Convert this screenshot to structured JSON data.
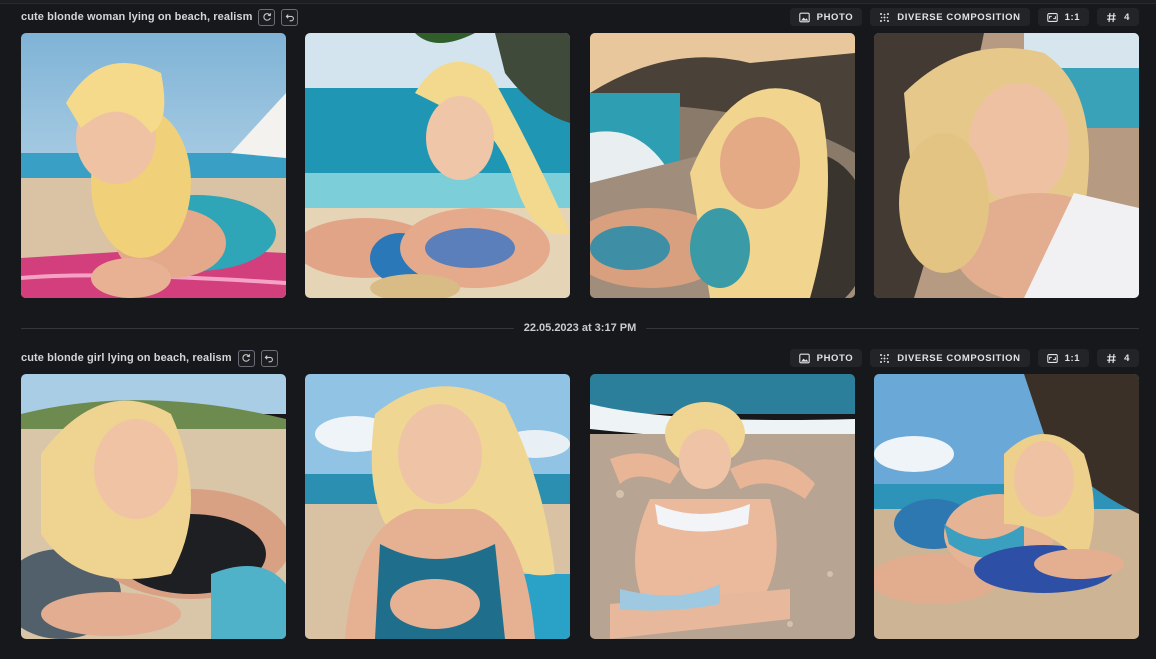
{
  "groups": [
    {
      "prompt": "cute blonde woman lying on beach, realism",
      "tags": {
        "style": "PHOTO",
        "composition": "DIVERSE COMPOSITION",
        "ratio": "1:1",
        "count": "4"
      },
      "images": [
        {
          "alt": "blonde woman in teal swimsuit lying on pink towel"
        },
        {
          "alt": "blonde woman in blue bikini lying on sand by turquoise sea"
        },
        {
          "alt": "smiling blonde woman lying on pebbled beach near rocks"
        },
        {
          "alt": "curly blonde woman lying on sand in white top"
        }
      ]
    },
    {
      "prompt": "cute blonde girl lying on beach, realism",
      "tags": {
        "style": "PHOTO",
        "composition": "DIVERSE COMPOSITION",
        "ratio": "1:1",
        "count": "4"
      },
      "images": [
        {
          "alt": "blonde girl in black swimsuit lying on sandy beach"
        },
        {
          "alt": "blonde girl in teal top sitting on beach with blue sky"
        },
        {
          "alt": "blonde girl in bikini lying on sand near waves"
        },
        {
          "alt": "blonde girl lying on blue pillow on beach"
        }
      ]
    }
  ],
  "timestamp": "22.05.2023 at 3:17 PM",
  "icons": {
    "regenerate": "refresh-icon",
    "undo": "undo-icon",
    "style": "image-icon",
    "composition": "composition-dots-icon",
    "ratio": "aspect-ratio-icon",
    "count": "hash-icon"
  }
}
